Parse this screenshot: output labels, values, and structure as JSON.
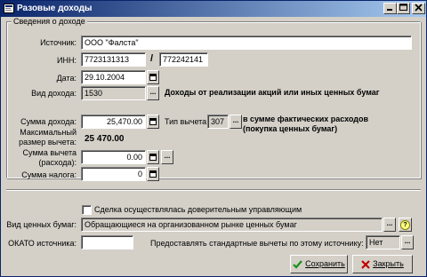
{
  "window": {
    "title": "Разовые доходы"
  },
  "group": {
    "legend": "Сведения о доходе"
  },
  "fields": {
    "source_label": "Источник:",
    "source_value": "ООО \"Фалста\"",
    "inn_label": "ИНН:",
    "inn_value": "7723131313",
    "inn_slash": "/",
    "kpp_value": "772242141",
    "date_label": "Дата:",
    "date_value": "29.10.2004",
    "income_type_label": "Вид дохода:",
    "income_type_value": "1530",
    "income_type_desc": "Доходы от реализации акций или иных ценных бумаг",
    "amount_label": "Сумма дохода:",
    "amount_value": "25,470.00",
    "deduction_type_label": "Тип вычета:",
    "deduction_type_value": "307",
    "deduction_type_desc": "в сумме фактических расходов (покупка ценных бумаг)",
    "max_deduction_label": "Максимальный размер вычета:",
    "max_deduction_value": "25 470.00",
    "deduction_sum_label": "Сумма вычета (расхода):",
    "deduction_sum_value": "0.00",
    "tax_sum_label": "Сумма налога:",
    "tax_sum_value": "0"
  },
  "bottom": {
    "trust_label": "Сделка осуществлялась доверительным управляющим",
    "security_type_label": "Вид ценных бумаг:",
    "security_type_value": "Обращающиеся на организованном рынке ценных бумаг",
    "okato_label": "ОКАТО источника:",
    "okato_value": "",
    "std_deductions_label": "Предоставлять стандартные вычеты по этому источнику:",
    "std_deductions_value": "Нет"
  },
  "buttons": {
    "ellipsis": "...",
    "help": "?",
    "save": "Сохранить",
    "close": "Закрыть"
  },
  "colors": {
    "titlebar_start": "#0a246a",
    "titlebar_end": "#a6caf0",
    "face": "#d4d0c8",
    "save_check": "#1a8f1a",
    "close_x": "#c00000"
  }
}
